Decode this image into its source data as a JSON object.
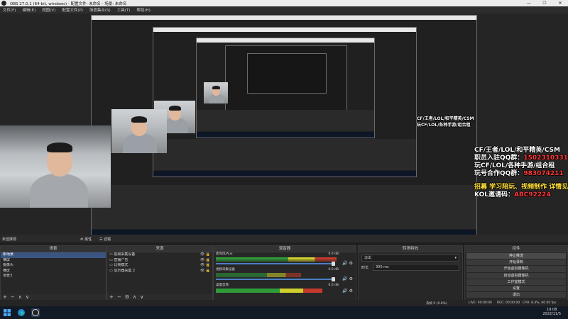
{
  "window": {
    "title": "OBS 27.0.1 (64-bit, windows) - 配置文件: 未命名 - 场景: 未命名",
    "controls": [
      "—",
      "☐",
      "✕"
    ]
  },
  "menu": [
    "文件(F)",
    "编辑(E)",
    "视图(V)",
    "配置文件(P)",
    "场景集合(S)",
    "工具(T)",
    "帮助(H)"
  ],
  "overlay": {
    "line1": "CF/王者/LOL/和平精英/CSM",
    "line2_label": "职员入驻QQ群：",
    "line2_value": "1502310331",
    "line3": "玩CF/LOL/各种手游/组合租",
    "line4_label": "玩号合作QQ群：",
    "line4_value": "983074211",
    "line5": "招募 学习陪玩、视频制作 详情见鱼吧",
    "line6_label": "KOL邀请码：",
    "line6_value": "ABC92224"
  },
  "scene_status": "未选择源",
  "preview_bottom": {
    "properties": "属性",
    "filters": "滤镜"
  },
  "docks": {
    "scenes": {
      "title": "场景",
      "items": [
        "新场景",
        "横屏",
        "摄像头",
        "横屏",
        "场景3"
      ],
      "selected": 0
    },
    "sources": {
      "title": "来源",
      "items": [
        "视频采集设备",
        "直播广告",
        "比赛模式",
        "显示器采集 2"
      ]
    },
    "mixer": {
      "title": "混音器",
      "channels": [
        {
          "name": "麦克风/Aux",
          "db": "0.0 dB"
        },
        {
          "name": "视频采集设备",
          "db": "0.0 dB"
        },
        {
          "name": "桌面音频",
          "db": "0.0 dB"
        }
      ]
    },
    "transitions": {
      "title": "转场特效",
      "type": "淡出",
      "duration_label": "时长",
      "duration_value": "300 ms"
    },
    "controls": {
      "title": "控件",
      "buttons": [
        "停止推流",
        "开始录制",
        "开始虚拟摄像机",
        "启动虚拟摄像机",
        "工作室模式",
        "设置",
        "退出"
      ]
    }
  },
  "footer_buttons": [
    "+",
    "−",
    "∧",
    "∨"
  ],
  "statusbar": {
    "dropped": "丢帧 0 (0.0%)",
    "live": "LIVE: 00:00:00",
    "rec": "REC: 00:00:00",
    "cpu": "CPU: 8.4%, 60.00 fps",
    "bitrate": "kb/s: 0"
  },
  "taskbar": {
    "time": "19:08",
    "date": "2022/11/5"
  }
}
